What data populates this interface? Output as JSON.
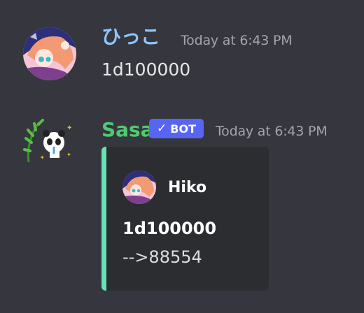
{
  "messages": [
    {
      "username": "ひっこ",
      "timestamp": "Today at 6:43 PM",
      "content": "1d100000"
    },
    {
      "username": "Sasa",
      "badge": "BOT",
      "timestamp": "Today at 6:43 PM",
      "embed": {
        "author": "Hiko",
        "title": "1d100000",
        "description": "-->88554",
        "accent_color": "#66e3b5"
      }
    }
  ],
  "colors": {
    "background": "#36373e",
    "user1_name": "#8ec5ff",
    "bot_name": "#4fca72",
    "bot_badge": "#5865f2",
    "embed_background": "#2b2d31"
  },
  "icons": {
    "badge_check": "✓"
  }
}
